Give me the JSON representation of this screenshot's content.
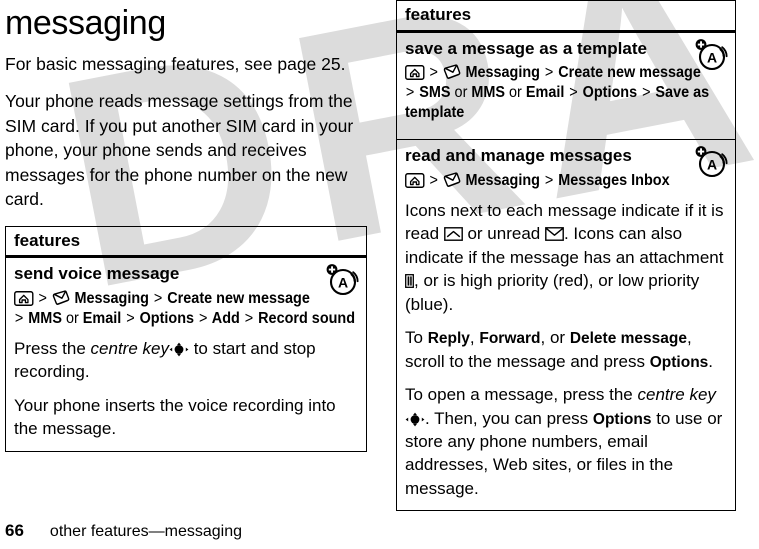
{
  "page": {
    "title": "messaging",
    "number": "66",
    "footer_text": "other features—messaging",
    "watermark": "DRAFT"
  },
  "intro": {
    "paragraph1": "For basic messaging features, see page 25.",
    "paragraph2": "Your phone reads message settings from the SIM card. If you put another SIM card in your phone, your phone sends and receives messages for the phone number on the new card."
  },
  "left_table": {
    "header": "features",
    "rows": [
      {
        "title": "send voice message",
        "badge": "audio-badge-icon",
        "path_line1_sep1": ">",
        "path_line1_item1": "Messaging",
        "path_line1_sep2": ">",
        "path_line1_item2": "Create new message",
        "path_line2_sep1": ">",
        "path_line2_item1": "MMS",
        "path_line2_or1": "or",
        "path_line2_item2": "Email",
        "path_line2_sep2": ">",
        "path_line2_item3": "Options",
        "path_line2_sep3": ">",
        "path_line2_item4": "Add",
        "path_line2_sep4": ">",
        "path_line2_item5": "Record sound",
        "body1_pre": "Press the ",
        "body1_italic": "centre key",
        "body1_post": " to start and stop recording.",
        "body2": "Your phone inserts the voice recording into the message."
      }
    ]
  },
  "right_table": {
    "header": "features",
    "rows": [
      {
        "title": "save a message as a template",
        "badge": "audio-badge-icon",
        "path_line1_sep1": ">",
        "path_line1_item1": "Messaging",
        "path_line1_sep2": ">",
        "path_line1_item2": "Create new message",
        "path_line2_sep1": ">",
        "path_line2_item1": "SMS",
        "path_line2_or1": "or",
        "path_line2_item2": "MMS",
        "path_line2_or2": "or",
        "path_line2_item3": "Email",
        "path_line2_sep2": ">",
        "path_line2_item4": "Options",
        "path_line2_sep3": ">",
        "path_line2_item5": "Save as template"
      },
      {
        "title": "read and manage messages",
        "badge": "audio-badge-icon",
        "path_line1_sep1": ">",
        "path_line1_item1": "Messaging",
        "path_line1_sep2": ">",
        "path_line1_item2": "Messages Inbox",
        "body1_a": "Icons next to each message indicate if it is read ",
        "body1_b": " or unread ",
        "body1_c": ". Icons can also indicate if the message has an attachment ",
        "body1_d": ", or is high priority (red), or low priority (blue).",
        "body2_a": "To ",
        "body2_reply": "Reply",
        "body2_b": ", ",
        "body2_forward": "Forward",
        "body2_c": ", or ",
        "body2_delete": "Delete message",
        "body2_d": ", scroll to the message and press ",
        "body2_options": "Options",
        "body2_e": ".",
        "body3_a": "To open a message, press the ",
        "body3_italic": "centre key",
        "body3_b": ". Then, you can press ",
        "body3_options": "Options",
        "body3_c": " to use or store any phone numbers, email addresses, Web sites, or files in the message."
      }
    ]
  },
  "colors": {
    "ink": "#000000",
    "paper": "#ffffff",
    "watermark": "#dcdcdc"
  }
}
